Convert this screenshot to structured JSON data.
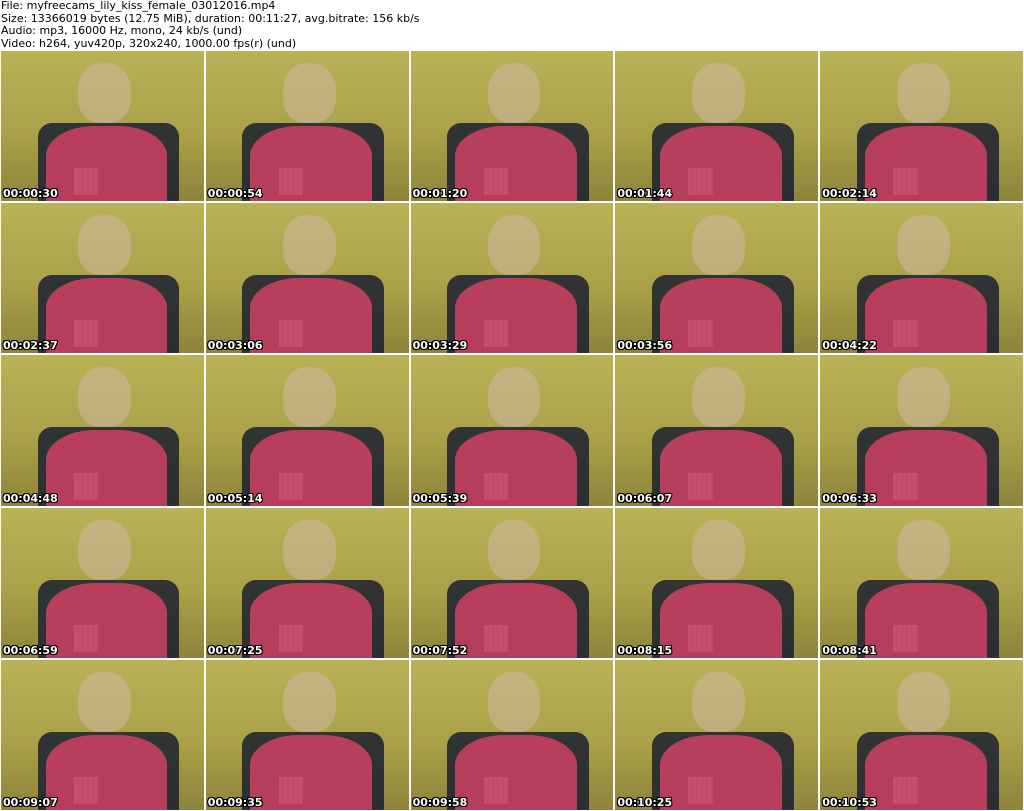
{
  "header": {
    "file_line": "File: myfreecams_lily_kiss_female_03012016.mp4",
    "size_line": "Size: 13366019 bytes (12.75 MiB), duration: 00:11:27, avg.bitrate: 156 kb/s",
    "audio_line": "Audio: mp3, 16000 Hz, mono, 24 kb/s (und)",
    "video_line": "Video: h264, yuv420p, 320x240, 1000.00 fps(r) (und)"
  },
  "thumbnails": [
    {
      "timestamp": "00:00:30"
    },
    {
      "timestamp": "00:00:54"
    },
    {
      "timestamp": "00:01:20"
    },
    {
      "timestamp": "00:01:44"
    },
    {
      "timestamp": "00:02:14"
    },
    {
      "timestamp": "00:02:37"
    },
    {
      "timestamp": "00:03:06"
    },
    {
      "timestamp": "00:03:29"
    },
    {
      "timestamp": "00:03:56"
    },
    {
      "timestamp": "00:04:22"
    },
    {
      "timestamp": "00:04:48"
    },
    {
      "timestamp": "00:05:14"
    },
    {
      "timestamp": "00:05:39"
    },
    {
      "timestamp": "00:06:07"
    },
    {
      "timestamp": "00:06:33"
    },
    {
      "timestamp": "00:06:59"
    },
    {
      "timestamp": "00:07:25"
    },
    {
      "timestamp": "00:07:52"
    },
    {
      "timestamp": "00:08:15"
    },
    {
      "timestamp": "00:08:41"
    },
    {
      "timestamp": "00:09:07"
    },
    {
      "timestamp": "00:09:35"
    },
    {
      "timestamp": "00:09:58"
    },
    {
      "timestamp": "00:10:25"
    },
    {
      "timestamp": "00:10:53"
    }
  ]
}
